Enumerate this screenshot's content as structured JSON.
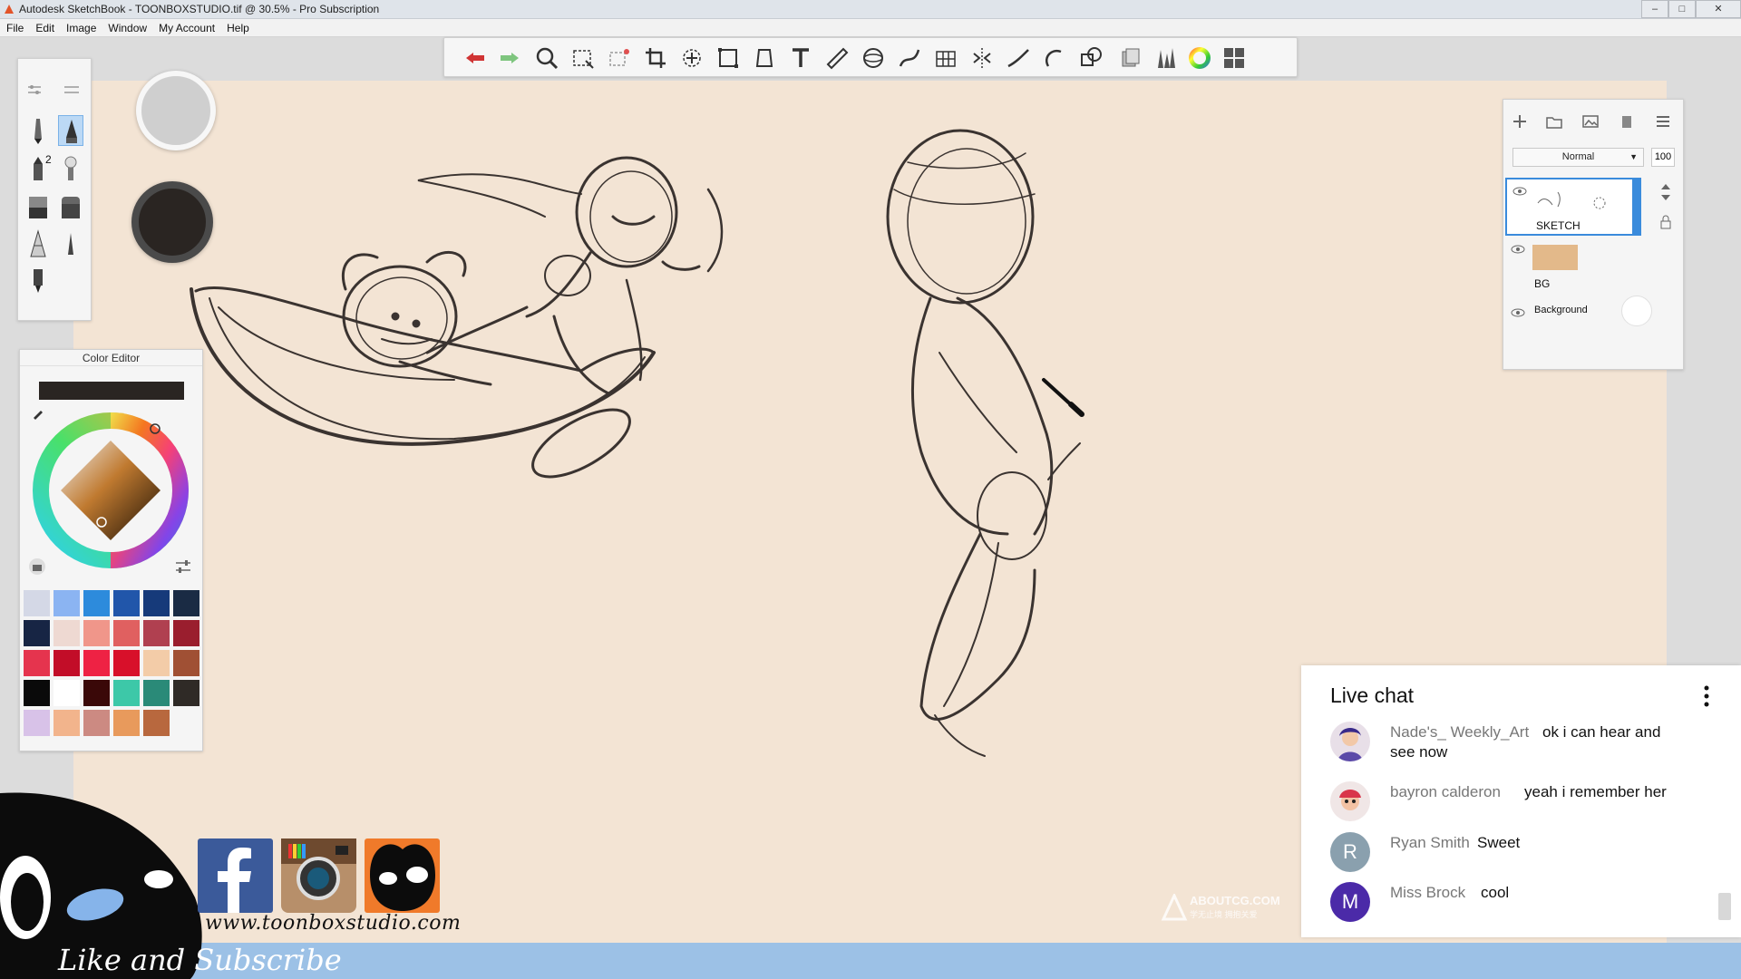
{
  "window": {
    "title": "Autodesk SketchBook - TOONBOXSTUDIO.tif @ 30.5% - Pro Subscription",
    "controls": [
      "minimize",
      "maximize",
      "close"
    ]
  },
  "menu": [
    "File",
    "Edit",
    "Image",
    "Window",
    "My Account",
    "Help"
  ],
  "toolbar": {
    "tools": [
      "undo-icon",
      "redo-icon",
      "zoom-icon",
      "select-icon",
      "lasso-select-icon",
      "crop-icon",
      "transform-icon",
      "distort-icon",
      "fill-icon",
      "text-icon",
      "ruler-icon",
      "ellipse-guide-icon",
      "french-curve-icon",
      "perspective-icon",
      "symmetry-icon",
      "stroke-icon",
      "shape-icon",
      "predictive-stroke-icon",
      "copic-icon",
      "brush-library-icon",
      "color-wheel-icon",
      "layers-icon"
    ]
  },
  "brush_palette": {
    "brushes": [
      "pencil",
      "ink-pen",
      "marker",
      "paintbrush",
      "airbrush-hard",
      "airbrush-soft",
      "smudge",
      "chisel-pen",
      "technical-pen"
    ],
    "active_index": 1,
    "badge": "2"
  },
  "color_editor": {
    "title": "Color Editor",
    "current_color": "#2a2522",
    "swatches": [
      "#d4d8e6",
      "#8bb4f2",
      "#2d8bdc",
      "#2156aa",
      "#163a7a",
      "#1a2b44",
      "#172544",
      "#eed9d2",
      "#f0968a",
      "#e06060",
      "#b04050",
      "#9a1e2e",
      "#e5344e",
      "#c20d28",
      "#ee2244",
      "#d8102a",
      "#f3cca8",
      "#a05034",
      "#0a0a0a",
      "#ffffff",
      "#3a0808",
      "#3dc8a8",
      "#2a8a78",
      "#2f2a26",
      "#d8c2e8",
      "#f2b48c",
      "#cc8a82",
      "#e89a5c",
      "#b8683e"
    ]
  },
  "layers": {
    "blend_mode": "Normal",
    "opacity": "100",
    "items": [
      {
        "name": "SKETCH",
        "selected": true
      },
      {
        "name": "BG",
        "selected": false
      },
      {
        "name": "Background",
        "selected": false
      }
    ]
  },
  "live_chat": {
    "title": "Live chat",
    "messages": [
      {
        "author": "Nade's_ Weekly_Art",
        "text": "ok i can hear and",
        "text2": "see now",
        "avatar_letter": "",
        "avatar_color": "#5b4aa8"
      },
      {
        "author": "bayron calderon",
        "text": "yeah i remember her",
        "avatar_letter": "",
        "avatar_color": "#d9354a"
      },
      {
        "author": "Ryan Smith",
        "text": "Sweet",
        "avatar_letter": "R",
        "avatar_color": "#8aa0ae"
      },
      {
        "author": "Miss Brock",
        "text": "cool",
        "avatar_letter": "M",
        "avatar_color": "#4b2aa8"
      }
    ]
  },
  "branding": {
    "site": "www.toonboxstudio.com",
    "tagline": "Like and Subscribe",
    "social": [
      "facebook-logo",
      "instagram-logo",
      "toonbox-logo"
    ],
    "watermark": "ABOUTCG.COM",
    "watermark_sub": "学无止境 拥抱关爱"
  },
  "colors": {
    "paper": "#f3e4d4",
    "accent": "#3a8bdc",
    "taskbar": "#9cc1e6"
  }
}
